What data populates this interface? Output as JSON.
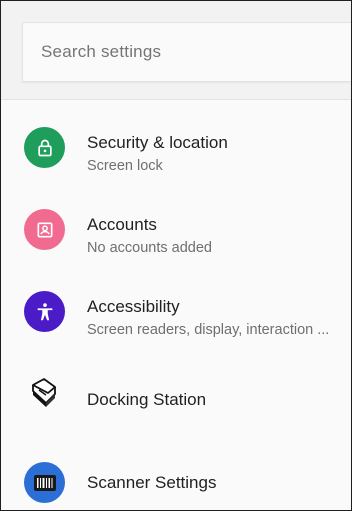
{
  "search": {
    "placeholder": "Search settings"
  },
  "items": [
    {
      "title": "Security & location",
      "subtitle": "Screen lock",
      "icon": "lock-icon",
      "color": "#1e9e5a"
    },
    {
      "title": "Accounts",
      "subtitle": "No accounts added",
      "icon": "account-box-icon",
      "color": "#f06b8f"
    },
    {
      "title": "Accessibility",
      "subtitle": "Screen readers, display, interaction ...",
      "icon": "accessibility-icon",
      "color": "#4a1bc7"
    },
    {
      "title": "Docking Station",
      "subtitle": "",
      "icon": "docking-station-icon",
      "color": "#000000"
    },
    {
      "title": "Scanner Settings",
      "subtitle": "",
      "icon": "barcode-scanner-icon",
      "color": "#2b6fd6"
    }
  ]
}
